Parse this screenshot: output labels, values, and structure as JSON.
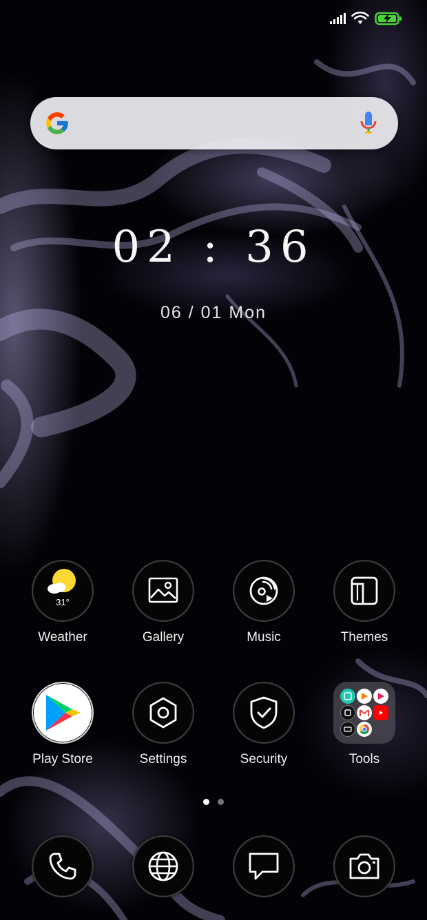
{
  "clock": {
    "time": "02 : 36",
    "date": "06 / 01 Mon"
  },
  "search": {
    "provider_icon": "google-g-icon",
    "voice_icon": "microphone-icon"
  },
  "status_bar": {
    "icons": [
      "signal-icon",
      "wifi-icon",
      "battery-charging-icon"
    ],
    "battery_color": "#4cd137"
  },
  "apps_row1": [
    {
      "label": "Weather",
      "icon": "weather-sun-icon",
      "temp": "31°"
    },
    {
      "label": "Gallery",
      "icon": "gallery-icon"
    },
    {
      "label": "Music",
      "icon": "music-icon"
    },
    {
      "label": "Themes",
      "icon": "themes-icon"
    }
  ],
  "apps_row2": [
    {
      "label": "Play Store",
      "icon": "play-store-icon"
    },
    {
      "label": "Settings",
      "icon": "settings-icon"
    },
    {
      "label": "Security",
      "icon": "security-icon"
    },
    {
      "label": "Tools",
      "icon": "tools-folder-icon"
    }
  ],
  "dock": [
    {
      "icon": "phone-icon"
    },
    {
      "icon": "browser-icon"
    },
    {
      "icon": "messages-icon"
    },
    {
      "icon": "camera-icon"
    }
  ],
  "pages": {
    "count": 2,
    "active": 1
  }
}
